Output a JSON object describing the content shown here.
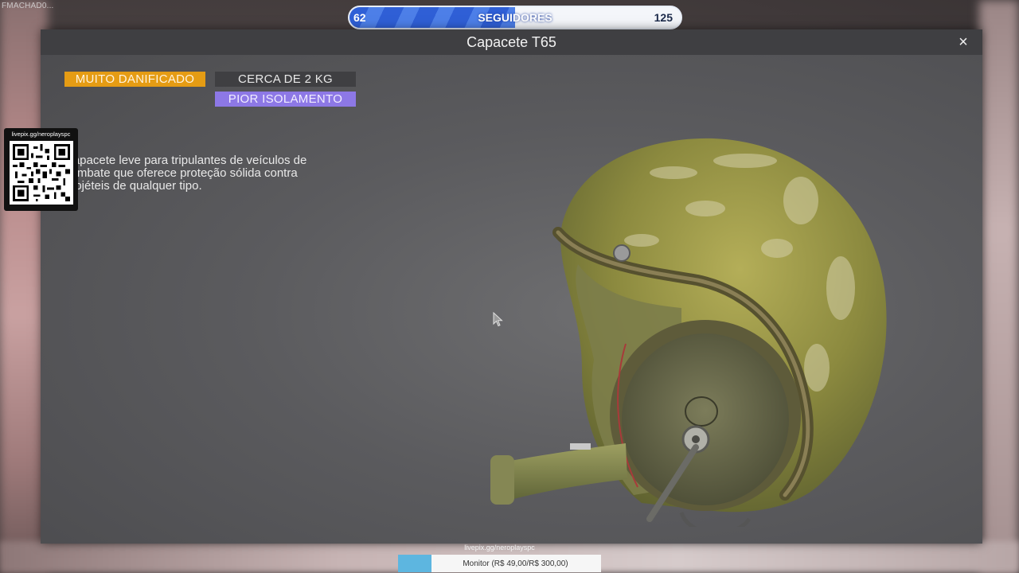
{
  "stream": {
    "streamer_tag": "FMACHAD0...",
    "followers": {
      "current": "62",
      "label": "SEGUIDORES",
      "goal": "125",
      "progress": 0.5
    },
    "qr": {
      "url": "livepix.gg/neroplayspc"
    },
    "monitor": {
      "url": "livepix.gg/neroplayspc",
      "text": "Monitor (R$ 49,00/R$ 300,00)",
      "progress": 0.163
    }
  },
  "item_panel": {
    "title": "Capacete T65",
    "close_label": "×",
    "tags": {
      "condition": "MUITO DANIFICADO",
      "weight": "CERCA DE 2 KG",
      "insulation": "PIOR ISOLAMENTO"
    },
    "description": "Capacete leve para tripulantes de veículos de combate que oferece proteção sólida contra projéteis de qualquer tipo."
  },
  "colors": {
    "condition_tag": "#e59c14",
    "insulation_tag": "#8d78e6",
    "followers_fill": "#2f5fd6",
    "monitor_fill": "#5db6e0"
  }
}
